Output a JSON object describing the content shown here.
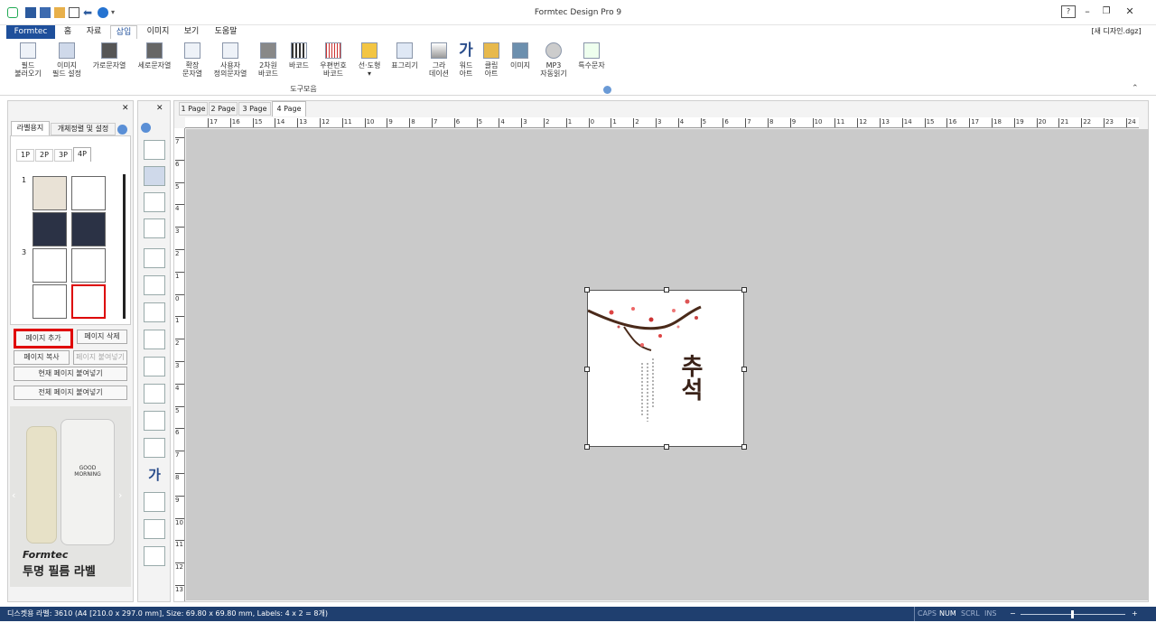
{
  "window": {
    "title": "Formtec Design Pro 9",
    "doc_name": "[새 디자인.dgz]"
  },
  "menu": {
    "tabs": [
      "Formtec",
      "홈",
      "자료",
      "삽입",
      "이미지",
      "보기",
      "도움말"
    ],
    "active": "삽입"
  },
  "ribbon": {
    "items": [
      {
        "label1": "필드",
        "label2": "불러오기"
      },
      {
        "label1": "이미지",
        "label2": "필드 설정"
      },
      {
        "label1": "가로문자열",
        "label2": ""
      },
      {
        "label1": "세로문자열",
        "label2": ""
      },
      {
        "label1": "확장",
        "label2": "문자열"
      },
      {
        "label1": "사용자",
        "label2": "정의문자열"
      },
      {
        "label1": "2차원",
        "label2": "바코드"
      },
      {
        "label1": "바코드",
        "label2": ""
      },
      {
        "label1": "우편번호",
        "label2": "바코드"
      },
      {
        "label1": "선·도형",
        "label2": "▾"
      },
      {
        "label1": "표그리기",
        "label2": ""
      },
      {
        "label1": "그라",
        "label2": "데이션"
      },
      {
        "label1": "워드",
        "label2": "아트"
      },
      {
        "label1": "클립",
        "label2": "아트"
      },
      {
        "label1": "이미지",
        "label2": ""
      },
      {
        "label1": "MP3",
        "label2": "자동읽기"
      },
      {
        "label1": "특수문자",
        "label2": ""
      }
    ],
    "group_label": "도구모음"
  },
  "left_panel": {
    "tabs": [
      "라벨용지",
      "개체정렬 및 설정"
    ],
    "page_tabs": [
      "1P",
      "2P",
      "3P",
      "4P"
    ],
    "active_page": "4P",
    "row_numbers": [
      "1",
      "3"
    ],
    "buttons": {
      "add_page": "페이지 추가",
      "delete_page": "페이지 삭제",
      "copy_page": "페이지 복사",
      "paste_page": "페이지 붙여넣기",
      "paste_current": "현재 페이지 붙여넣기",
      "paste_all": "전체 페이지 붙여넣기"
    },
    "ad": {
      "brand": "Formtec",
      "text": "투명 필름 라벨",
      "bottle_text": "GOOD MORNING"
    }
  },
  "page_tabs": [
    "1 Page",
    "2 Page",
    "3 Page",
    "4 Page"
  ],
  "active_page_tab": "4 Page",
  "canvas": {
    "label_title": "추석"
  },
  "ruler": {
    "top": [
      "17",
      "16",
      "15",
      "14",
      "13",
      "12",
      "11",
      "10",
      "9",
      "8",
      "7",
      "6",
      "5",
      "4",
      "3",
      "2",
      "1",
      "0",
      "1",
      "2",
      "3",
      "4",
      "5",
      "6",
      "7",
      "8",
      "9",
      "10",
      "11",
      "12",
      "13",
      "14",
      "15",
      "16",
      "17",
      "18",
      "19",
      "20",
      "21",
      "22",
      "23",
      "24"
    ],
    "left": [
      "7",
      "6",
      "5",
      "4",
      "3",
      "2",
      "1",
      "0",
      "1",
      "2",
      "3",
      "4",
      "5",
      "6",
      "7",
      "8",
      "9",
      "10",
      "11",
      "12",
      "13"
    ]
  },
  "status": {
    "text": "디스켓용 라벨: 3610 (A4 [210.0 x 297.0 mm], Size: 69.80 x 69.80 mm,  Labels: 4 x 2 = 8개)",
    "indicators": [
      "CAPS",
      "NUM",
      "SCRL",
      "INS"
    ],
    "active_indicator": "NUM",
    "zoom_minus": "−",
    "zoom_plus": "+"
  },
  "colors": {
    "accent": "#1e4f9b",
    "status_bg": "#1f3f6f",
    "highlight": "#e00000"
  }
}
